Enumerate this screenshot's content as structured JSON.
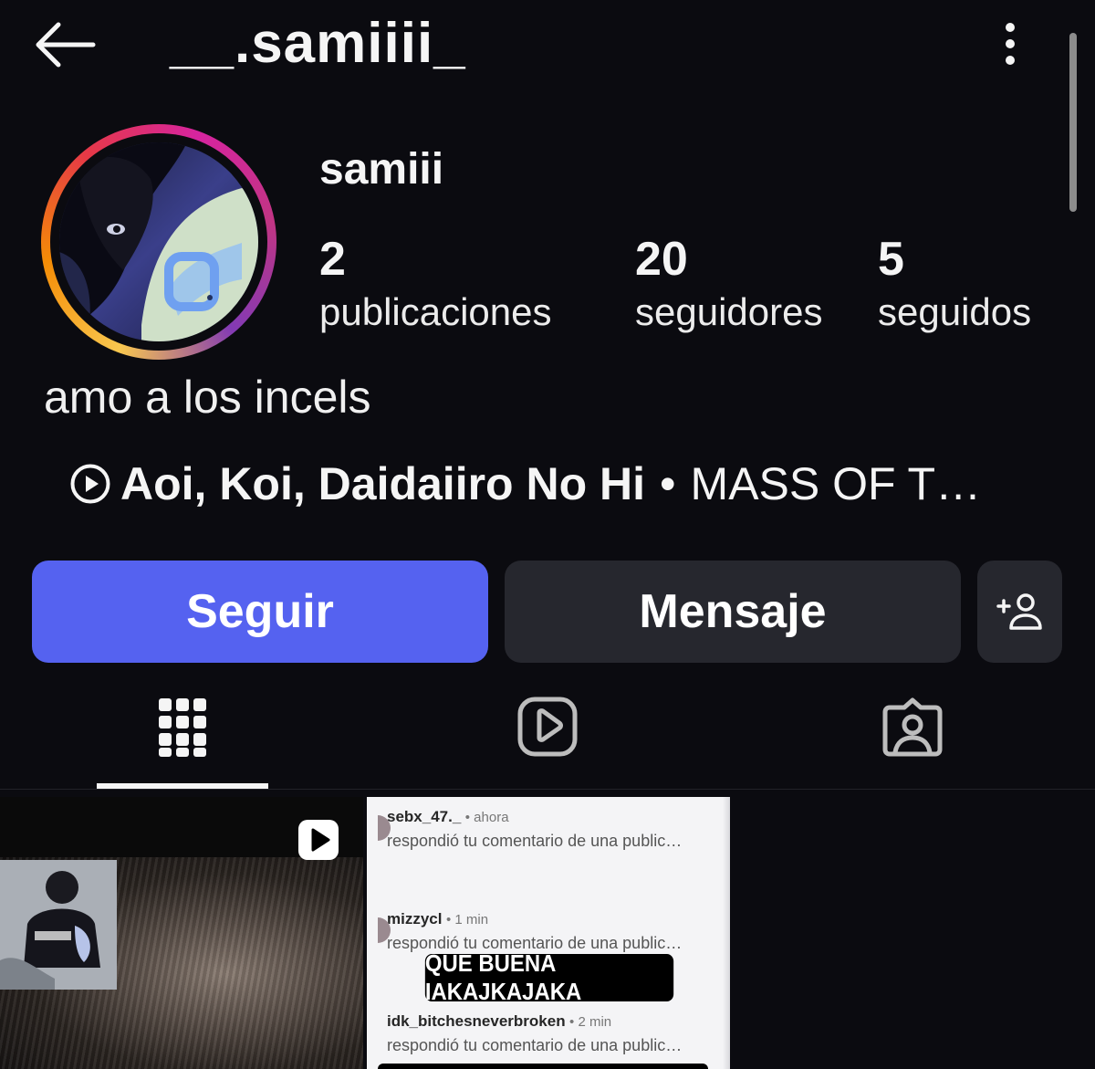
{
  "topbar": {
    "username": "__.samiiii_",
    "back_icon": "arrow-left-icon",
    "more_icon": "more-vertical-icon"
  },
  "profile": {
    "display_name": "samiii",
    "stats": {
      "posts": {
        "value": "2",
        "label": "publicaciones"
      },
      "followers": {
        "value": "20",
        "label": "seguidores"
      },
      "following": {
        "value": "5",
        "label": "seguidos"
      }
    },
    "bio": "amo a los incels",
    "music": {
      "icon": "play-circle-icon",
      "title": "Aoi, Koi, Daidaiiro No Hi",
      "separator": "•",
      "artist": "MASS OF T…"
    }
  },
  "actions": {
    "follow_label": "Seguir",
    "message_label": "Mensaje",
    "add_icon": "add-person-icon"
  },
  "tabs": [
    {
      "name": "grid",
      "icon": "grid-icon",
      "active": true
    },
    {
      "name": "reels",
      "icon": "reels-icon",
      "active": false
    },
    {
      "name": "tagged",
      "icon": "tagged-icon",
      "active": false
    }
  ],
  "posts": {
    "post_1": {
      "type": "reel",
      "badge_icon": "reel-play-icon"
    },
    "post_2": {
      "notifications": [
        {
          "user": "sebx_47._",
          "time": "• ahora",
          "text": "respondió tu comentario de una public…"
        },
        {
          "user": "mizzycl",
          "time": "• 1 min",
          "text": "respondió tu comentario de una public…"
        },
        {
          "user": "idk_bitchesneverbroken",
          "time": "• 2 min",
          "text": "respondió tu comentario de una public…"
        }
      ],
      "sticker": "QUE BUENA IAKAJKAJAKA"
    }
  },
  "colors": {
    "background": "#0b0b10",
    "follow_button": "#5562f0",
    "secondary_button": "#26272e",
    "text": "#f5f5f5"
  }
}
